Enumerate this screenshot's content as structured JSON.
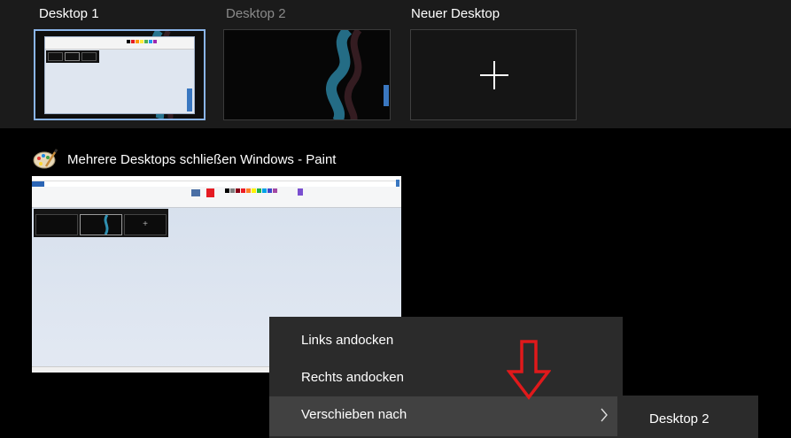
{
  "desktops": [
    {
      "label": "Desktop 1",
      "active": true
    },
    {
      "label": "Desktop 2",
      "active": false
    },
    {
      "label": "Neuer Desktop",
      "active": false
    }
  ],
  "window": {
    "title": "Mehrere Desktops schließen Windows - Paint",
    "icon": "paint-palette-icon"
  },
  "context_menu": {
    "items": [
      {
        "label": "Links andocken"
      },
      {
        "label": "Rechts andocken"
      },
      {
        "label": "Verschieben nach",
        "has_submenu": true,
        "highlighted": true
      }
    ]
  },
  "submenu": {
    "items": [
      {
        "label": "Desktop 2"
      }
    ]
  },
  "colors": {
    "desktop_bar": "#1b1b1b",
    "active_border": "#8ab4e8",
    "menu_bg": "#2b2b2b",
    "menu_highlight": "#414141",
    "annotation": "#e0191b",
    "swirl": "#2f8fb0"
  },
  "annotation_icon": "red-arrow-down-icon"
}
